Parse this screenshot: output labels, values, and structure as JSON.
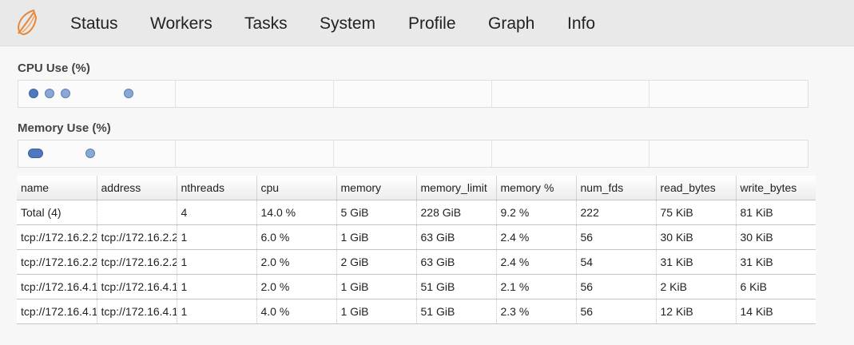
{
  "nav": {
    "logo_icon": "dask-logo-icon",
    "items": [
      "Status",
      "Workers",
      "Tasks",
      "System",
      "Profile",
      "Graph",
      "Info"
    ]
  },
  "cpu_section": {
    "title": "CPU Use (%)",
    "marker_count": 4
  },
  "memory_section": {
    "title": "Memory Use (%)",
    "marker_count": 2
  },
  "colors": {
    "marker_fill": "#8aa7d6",
    "marker_dark": "#4f78bd",
    "navbar_bg": "#e9e9e9",
    "logo_orange": "#e6873a"
  },
  "table": {
    "columns": [
      "name",
      "address",
      "nthreads",
      "cpu",
      "memory",
      "memory_limit",
      "memory %",
      "num_fds",
      "read_bytes",
      "write_bytes"
    ],
    "rows": [
      [
        "Total (4)",
        "",
        "4",
        "14.0 %",
        "5 GiB",
        "228 GiB",
        "9.2 %",
        "222",
        "75 KiB",
        "81 KiB"
      ],
      [
        "tcp://172.16.2.2",
        "tcp://172.16.2.2",
        "1",
        "6.0 %",
        "1 GiB",
        "63 GiB",
        "2.4 %",
        "56",
        "30 KiB",
        "30 KiB"
      ],
      [
        "tcp://172.16.2.2",
        "tcp://172.16.2.2",
        "1",
        "2.0 %",
        "2 GiB",
        "63 GiB",
        "2.4 %",
        "54",
        "31 KiB",
        "31 KiB"
      ],
      [
        "tcp://172.16.4.1",
        "tcp://172.16.4.1",
        "1",
        "2.0 %",
        "1 GiB",
        "51 GiB",
        "2.1 %",
        "56",
        "2 KiB",
        "6 KiB"
      ],
      [
        "tcp://172.16.4.1",
        "tcp://172.16.4.1",
        "1",
        "4.0 %",
        "1 GiB",
        "51 GiB",
        "2.3 %",
        "56",
        "12 KiB",
        "14 KiB"
      ]
    ]
  }
}
